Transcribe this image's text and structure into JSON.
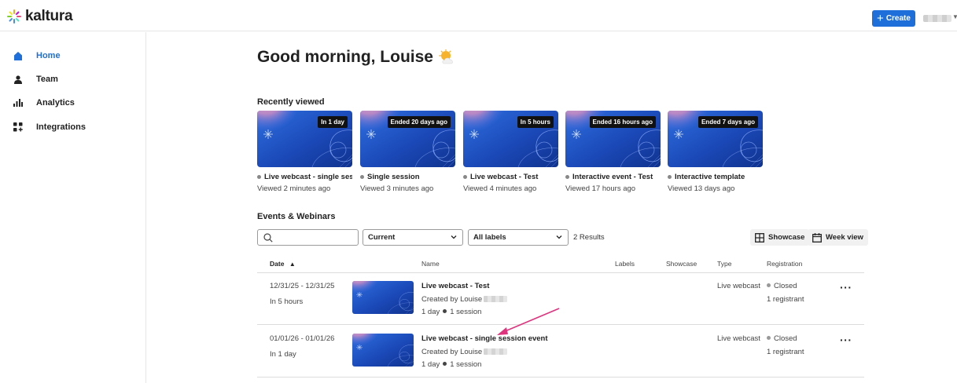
{
  "brand": {
    "name": "kaltura"
  },
  "header": {
    "create_label": "Create"
  },
  "sidebar": {
    "items": [
      {
        "label": "Home",
        "icon": "home-icon",
        "active": true
      },
      {
        "label": "Team",
        "icon": "user-icon",
        "active": false
      },
      {
        "label": "Analytics",
        "icon": "bar-chart-icon",
        "active": false
      },
      {
        "label": "Integrations",
        "icon": "integrations-icon",
        "active": false
      }
    ]
  },
  "main": {
    "greeting": "Good morning, Louise",
    "greeting_icon": "sun-cloud-icon",
    "recently_viewed": {
      "title": "Recently viewed",
      "cards": [
        {
          "badge": "In 1 day",
          "title": "Live webcast - single sessi...",
          "viewed": "Viewed 2 minutes ago"
        },
        {
          "badge": "Ended 20 days ago",
          "title": "Single session",
          "viewed": "Viewed 3 minutes ago"
        },
        {
          "badge": "In 5 hours",
          "title": "Live webcast - Test",
          "viewed": "Viewed 4 minutes ago"
        },
        {
          "badge": "Ended 16 hours ago",
          "title": "Interactive event - Test",
          "viewed": "Viewed 17 hours ago"
        },
        {
          "badge": "Ended 7 days ago",
          "title": "Interactive template",
          "viewed": "Viewed 13 days ago"
        }
      ]
    },
    "events": {
      "title": "Events & Webinars",
      "search_placeholder": "",
      "filter_status": "Current",
      "filter_labels": "All labels",
      "results": "2 Results",
      "showcase_label": "Showcase",
      "week_view_label": "Week view",
      "columns": {
        "date": "Date",
        "name": "Name",
        "labels": "Labels",
        "showcase": "Showcase",
        "type": "Type",
        "registration": "Registration"
      },
      "rows": [
        {
          "date": "12/31/25 - 12/31/25",
          "relative": "In 5 hours",
          "name": "Live webcast - Test",
          "created_by": "Created by Louise",
          "duration": "1 day",
          "sessions": "1 session",
          "type": "Live webcast",
          "status": "Closed",
          "registrants": "1 registrant"
        },
        {
          "date": "01/01/26 - 01/01/26",
          "relative": "In 1 day",
          "name": "Live webcast - single session event",
          "created_by": "Created by Louise",
          "duration": "1 day",
          "sessions": "1 session",
          "type": "Live webcast",
          "status": "Closed",
          "registrants": "1 registrant"
        }
      ]
    }
  },
  "colors": {
    "accent": "#1e6fd9",
    "annotation_arrow": "#e0337e"
  }
}
